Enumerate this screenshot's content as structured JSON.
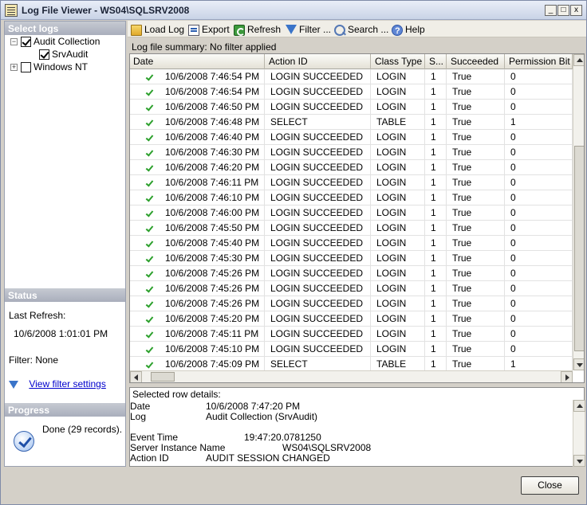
{
  "window": {
    "title": "Log File Viewer - WS04\\SQLSRV2008",
    "minimize": "_",
    "maximize": "□",
    "close": "x"
  },
  "left": {
    "select_logs_header": "Select logs",
    "tree": [
      {
        "label": "Audit Collection",
        "checked": true,
        "expanded": true,
        "expander": "−"
      },
      {
        "label": "SrvAudit",
        "checked": true
      },
      {
        "label": "Windows NT",
        "checked": false,
        "expanded": false,
        "expander": "+"
      }
    ],
    "status_header": "Status",
    "last_refresh_label": "Last Refresh:",
    "last_refresh_value": "10/6/2008 1:01:01 PM",
    "filter_text": "Filter: None",
    "view_filter_link": "View filter settings",
    "progress_header": "Progress",
    "progress_text": "Done (29 records)."
  },
  "toolbar": {
    "load_log": "Load Log",
    "export": "Export",
    "refresh": "Refresh",
    "filter": "Filter ...",
    "search": "Search ...",
    "help": "Help"
  },
  "summary": "Log file summary: No filter applied",
  "grid": {
    "columns": [
      "Date",
      "Action ID",
      "Class Type",
      "S...",
      "Succeeded",
      "Permission Bit Ma"
    ],
    "rows": [
      [
        "10/6/2008 7:46:54 PM",
        "LOGIN SUCCEEDED",
        "LOGIN",
        "1",
        "True",
        "0"
      ],
      [
        "10/6/2008 7:46:54 PM",
        "LOGIN SUCCEEDED",
        "LOGIN",
        "1",
        "True",
        "0"
      ],
      [
        "10/6/2008 7:46:50 PM",
        "LOGIN SUCCEEDED",
        "LOGIN",
        "1",
        "True",
        "0"
      ],
      [
        "10/6/2008 7:46:48 PM",
        "SELECT",
        "TABLE",
        "1",
        "True",
        "1"
      ],
      [
        "10/6/2008 7:46:40 PM",
        "LOGIN SUCCEEDED",
        "LOGIN",
        "1",
        "True",
        "0"
      ],
      [
        "10/6/2008 7:46:30 PM",
        "LOGIN SUCCEEDED",
        "LOGIN",
        "1",
        "True",
        "0"
      ],
      [
        "10/6/2008 7:46:20 PM",
        "LOGIN SUCCEEDED",
        "LOGIN",
        "1",
        "True",
        "0"
      ],
      [
        "10/6/2008 7:46:11 PM",
        "LOGIN SUCCEEDED",
        "LOGIN",
        "1",
        "True",
        "0"
      ],
      [
        "10/6/2008 7:46:10 PM",
        "LOGIN SUCCEEDED",
        "LOGIN",
        "1",
        "True",
        "0"
      ],
      [
        "10/6/2008 7:46:00 PM",
        "LOGIN SUCCEEDED",
        "LOGIN",
        "1",
        "True",
        "0"
      ],
      [
        "10/6/2008 7:45:50 PM",
        "LOGIN SUCCEEDED",
        "LOGIN",
        "1",
        "True",
        "0"
      ],
      [
        "10/6/2008 7:45:40 PM",
        "LOGIN SUCCEEDED",
        "LOGIN",
        "1",
        "True",
        "0"
      ],
      [
        "10/6/2008 7:45:30 PM",
        "LOGIN SUCCEEDED",
        "LOGIN",
        "1",
        "True",
        "0"
      ],
      [
        "10/6/2008 7:45:26 PM",
        "LOGIN SUCCEEDED",
        "LOGIN",
        "1",
        "True",
        "0"
      ],
      [
        "10/6/2008 7:45:26 PM",
        "LOGIN SUCCEEDED",
        "LOGIN",
        "1",
        "True",
        "0"
      ],
      [
        "10/6/2008 7:45:26 PM",
        "LOGIN SUCCEEDED",
        "LOGIN",
        "1",
        "True",
        "0"
      ],
      [
        "10/6/2008 7:45:20 PM",
        "LOGIN SUCCEEDED",
        "LOGIN",
        "1",
        "True",
        "0"
      ],
      [
        "10/6/2008 7:45:11 PM",
        "LOGIN SUCCEEDED",
        "LOGIN",
        "1",
        "True",
        "0"
      ],
      [
        "10/6/2008 7:45:10 PM",
        "LOGIN SUCCEEDED",
        "LOGIN",
        "1",
        "True",
        "0"
      ],
      [
        "10/6/2008 7:45:09 PM",
        "SELECT",
        "TABLE",
        "1",
        "True",
        "1"
      ]
    ]
  },
  "details": {
    "header": "Selected row details:",
    "lines": [
      {
        "label": "Date",
        "value": "10/6/2008 7:47:20 PM"
      },
      {
        "label": "Log",
        "value": "Audit Collection (SrvAudit)"
      },
      {
        "label": "Event Time",
        "value": "19:47:20.0781250"
      },
      {
        "label": "Server Instance Name",
        "value": "WS04\\SQLSRV2008"
      },
      {
        "label": "Action ID",
        "value": "AUDIT SESSION CHANGED"
      }
    ]
  },
  "close_button": "Close",
  "colors": {
    "check_green": "#2ca02c",
    "link_blue": "#0000cc",
    "panel_header": "#a9aebc"
  }
}
